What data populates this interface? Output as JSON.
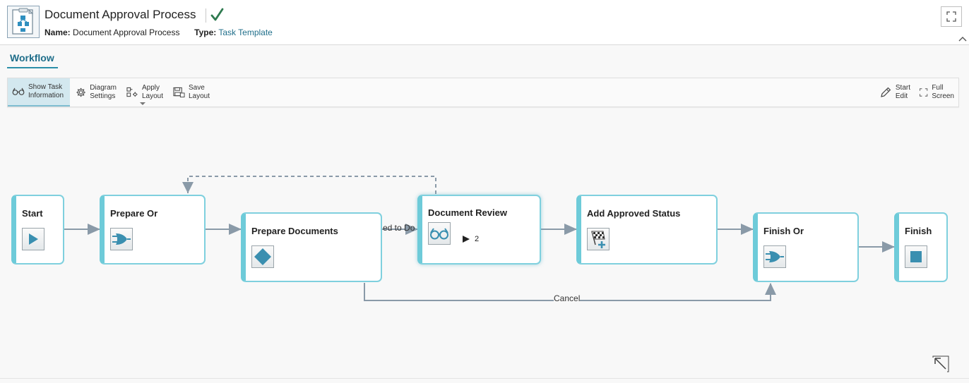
{
  "header": {
    "title": "Document Approval Process",
    "name_label": "Name:",
    "name_value": "Document Approval Process",
    "type_label": "Type:",
    "type_value": "Task Template",
    "icons": [
      "document-template-icon",
      "checkmark-icon",
      "expand-icon",
      "chevron-up-icon"
    ]
  },
  "tabs": [
    {
      "label": "Workflow",
      "active": true
    }
  ],
  "toolbar": {
    "show_task_l1": "Show Task",
    "show_task_l2": "Information",
    "diagram_l1": "Diagram",
    "diagram_l2": "Settings",
    "apply_l1": "Apply",
    "apply_l2": "Layout",
    "save_l1": "Save",
    "save_l2": "Layout",
    "start_edit_l1": "Start",
    "start_edit_l2": "Edit",
    "full_screen_l1": "Full",
    "full_screen_l2": "Screen"
  },
  "workflow": {
    "nodes": {
      "start": "Start",
      "prepare_or": "Prepare Or",
      "prepare_documents": "Prepare Documents",
      "document_review": "Document Review",
      "document_review_count": "2",
      "add_approved_status": "Add Approved Status",
      "finish_or": "Finish Or",
      "finish": "Finish"
    },
    "connections": {
      "cancel": "Cancel",
      "partial": "ed to Do"
    }
  },
  "colors": {
    "accent": "#2b8fa8",
    "node_border": "#6ecbd9",
    "arrow": "#8a9aa8",
    "icon_fill": "#3a8fb0"
  }
}
